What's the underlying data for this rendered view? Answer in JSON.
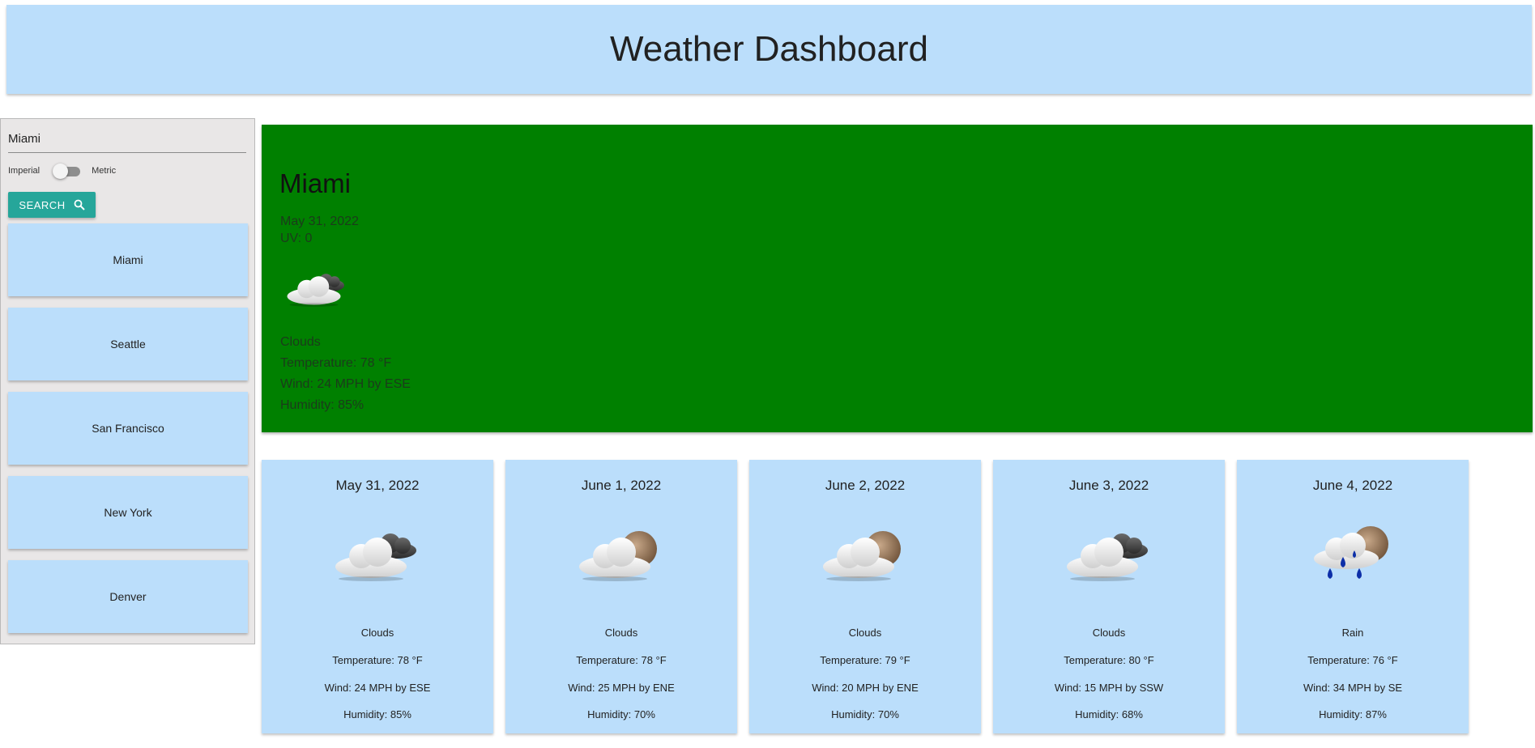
{
  "header": {
    "title": "Weather Dashboard"
  },
  "sidebar": {
    "search_value": "Miami",
    "units": {
      "left_label": "Imperial",
      "right_label": "Metric",
      "metric_enabled": false
    },
    "search_button_label": "SEARCH",
    "search_icon": "search-icon",
    "cities": [
      "Miami",
      "Seattle",
      "San Francisco",
      "New York",
      "Denver"
    ]
  },
  "current": {
    "city": "Miami",
    "date": "May 31, 2022",
    "uv": "UV: 0",
    "icon": "cloudy-night-icon",
    "description": "Clouds",
    "temperature": "Temperature: 78 °F",
    "wind": "Wind: 24 MPH by ESE",
    "humidity": "Humidity: 85%",
    "background_color": "#008000"
  },
  "forecast": [
    {
      "date": "May 31, 2022",
      "icon": "cloudy-night-icon",
      "description": "Clouds",
      "temperature": "Temperature: 78 °F",
      "wind": "Wind: 24 MPH by ESE",
      "humidity": "Humidity: 85%"
    },
    {
      "date": "June 1, 2022",
      "icon": "partly-cloudy-icon",
      "description": "Clouds",
      "temperature": "Temperature: 78 °F",
      "wind": "Wind: 25 MPH by ENE",
      "humidity": "Humidity: 70%"
    },
    {
      "date": "June 2, 2022",
      "icon": "partly-cloudy-icon",
      "description": "Clouds",
      "temperature": "Temperature: 79 °F",
      "wind": "Wind: 20 MPH by ENE",
      "humidity": "Humidity: 70%"
    },
    {
      "date": "June 3, 2022",
      "icon": "cloudy-night-icon",
      "description": "Clouds",
      "temperature": "Temperature: 80 °F",
      "wind": "Wind: 15 MPH by SSW",
      "humidity": "Humidity: 68%"
    },
    {
      "date": "June 4, 2022",
      "icon": "rain-icon",
      "description": "Rain",
      "temperature": "Temperature: 76 °F",
      "wind": "Wind: 34 MPH by SE",
      "humidity": "Humidity: 87%"
    }
  ],
  "colors": {
    "panel": "#bbdefb",
    "button": "#26a69a",
    "sidebar_bg": "#e9e7e7"
  }
}
